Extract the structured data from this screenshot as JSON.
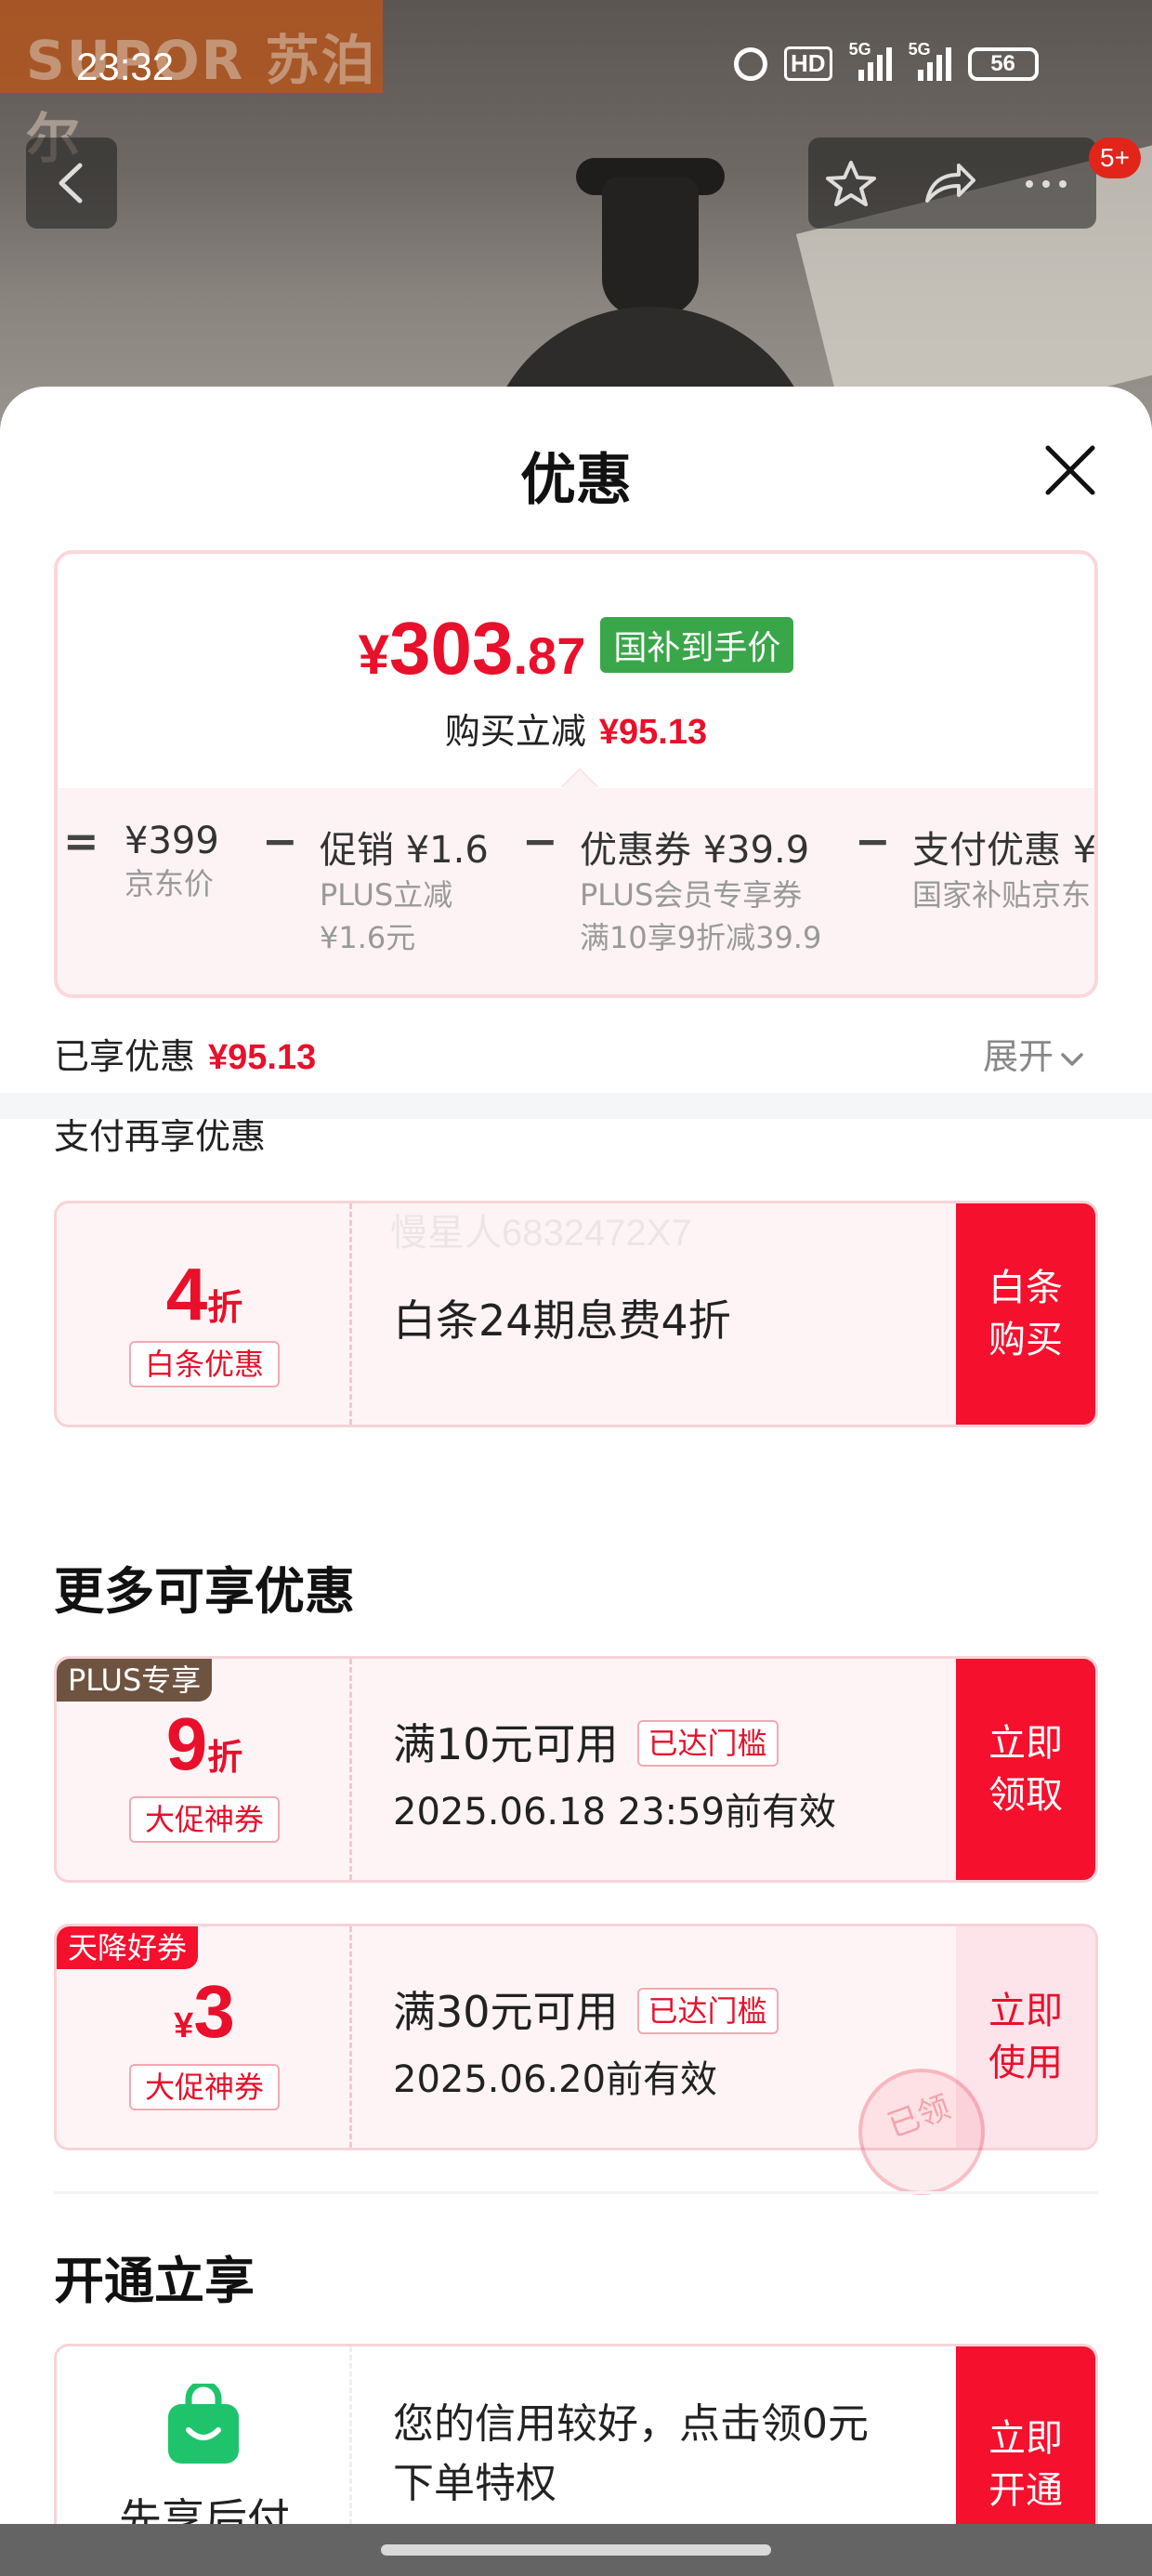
{
  "status_bar": {
    "time": "23:32",
    "hd_label": "HD",
    "network_1": "5G",
    "network_2": "5G",
    "battery": "56",
    "icons": [
      "alarm-icon",
      "hd-icon",
      "signal-icon",
      "signal-icon",
      "battery-icon"
    ]
  },
  "header_bg": {
    "brand_watermark": "SUPOR 苏泊尔"
  },
  "nav": {
    "back_icon": "chevron-left-icon",
    "favorite_icon": "star-icon",
    "share_icon": "share-icon",
    "more_icon": "more-icon",
    "badge": "5+"
  },
  "sheet": {
    "title": "优惠",
    "close_icon": "close-icon"
  },
  "summary": {
    "currency": "¥",
    "price_int": "303",
    "price_dec": ".87",
    "price_tag": "国补到手价",
    "save_label": "购买立减",
    "save_amount": "¥95.13",
    "breakdown": [
      {
        "op": "=",
        "main": "¥399",
        "sub": [
          "京东价"
        ]
      },
      {
        "op": "−",
        "main": "促销 ¥1.6",
        "sub": [
          "PLUS立减",
          "¥1.6元"
        ]
      },
      {
        "op": "−",
        "main": "优惠券 ¥39.9",
        "sub": [
          "PLUS会员专享券",
          "满10享9折减39.9"
        ]
      },
      {
        "op": "−",
        "main": "支付优惠 ¥",
        "sub": [
          "国家补贴京东"
        ]
      }
    ]
  },
  "enjoyed": {
    "label": "已享优惠",
    "amount": "¥95.13",
    "expand": "展开"
  },
  "pay_more_label": "支付再享优惠",
  "watermark": "慢星人6832472X7",
  "baitiao_offer": {
    "value": "4",
    "unit": "折",
    "tag": "白条优惠",
    "desc": "白条24期息费4折",
    "action": [
      "白条",
      "购买"
    ]
  },
  "more_section": {
    "title": "更多可享优惠",
    "coupons": [
      {
        "corner": "PLUS专享",
        "corner_color": "#6e5340",
        "value": "9",
        "unit": "折",
        "prefix": "",
        "tag": "大促神券",
        "condition": "满10元可用",
        "threshold": "已达门槛",
        "validity": "2025.06.18 23:59前有效",
        "action": [
          "立即",
          "领取"
        ]
      },
      {
        "corner": "天降好券",
        "corner_color": "#f5102e",
        "value": "3",
        "unit": "",
        "prefix": "¥",
        "tag": "大促神券",
        "condition": "满30元可用",
        "threshold": "已达门槛",
        "validity": "2025.06.20前有效",
        "action": [
          "立即",
          "使用"
        ],
        "stamp": "已领"
      }
    ]
  },
  "open_section": {
    "title": "开通立享",
    "card": {
      "icon": "shopping-bag-icon",
      "name": "先享后付",
      "desc_line1": "您的信用较好，点击领0元",
      "desc_line2": "下单特权",
      "action": [
        "立即",
        "开通"
      ]
    }
  },
  "colors": {
    "accent_red": "#e8102b",
    "action_red": "#f5102e",
    "green_tag": "#3aa64a"
  }
}
